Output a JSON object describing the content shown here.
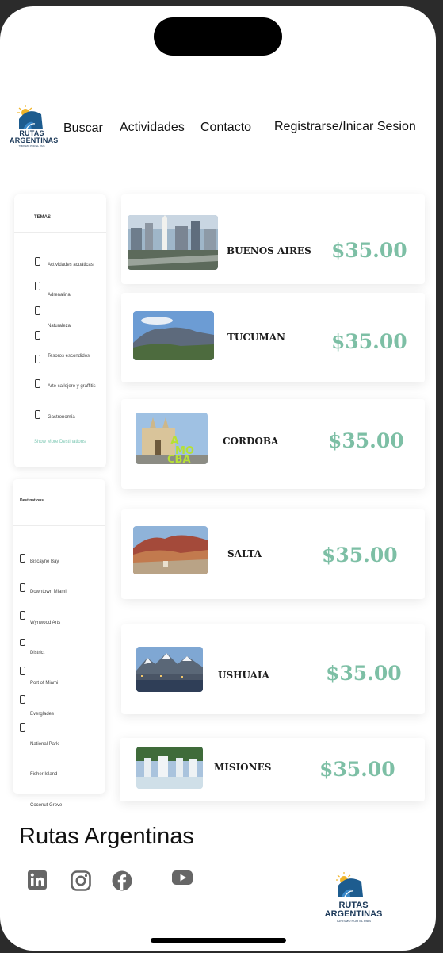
{
  "brand": {
    "logo_line1": "RUTAS",
    "logo_line2": "ARGENTINAS",
    "logo_tagline": "TURISMO POR EL PAIS"
  },
  "nav": [
    {
      "label": "Buscar"
    },
    {
      "label": "Actividades"
    },
    {
      "label": "Contacto"
    },
    {
      "label": "Registrarse/Inicar Sesion"
    }
  ],
  "temas": {
    "title": "TEMAS",
    "items": [
      "Actividades acuáticas",
      "Adrenalina",
      "Naturaleza",
      "Tesoros escondidos",
      "Arte callejero y graffitis",
      "Gastronomía"
    ],
    "show_more": "Show More Destinations"
  },
  "destinos": {
    "title": "Destinations",
    "items": [
      "Biscayne Bay",
      "Downtown Miami",
      "Wynwood Arts",
      "District",
      "Port of Miami",
      "Everglades",
      "National Park",
      "Fisher Island",
      "Coconut Grove"
    ]
  },
  "cards": [
    {
      "city": "BUENOS AIRES",
      "price": "$35.00"
    },
    {
      "city": "TUCUMAN",
      "price": "$35.00"
    },
    {
      "city": "CORDOBA",
      "price": "$35.00"
    },
    {
      "city": "SALTA",
      "price": "$35.00"
    },
    {
      "city": "USHUAIA",
      "price": "$35.00"
    },
    {
      "city": "MISIONES",
      "price": "$35.00"
    }
  ],
  "footer": {
    "title": "Rutas Argentinas"
  },
  "social_icons": [
    "linkedin-icon",
    "instagram-icon",
    "facebook-icon",
    "youtube-icon"
  ],
  "colors": {
    "price": "#7dbfa5",
    "show_more": "#7ec8b4",
    "logo_blue": "#1d5c8f",
    "logo_sun": "#f0b429"
  }
}
